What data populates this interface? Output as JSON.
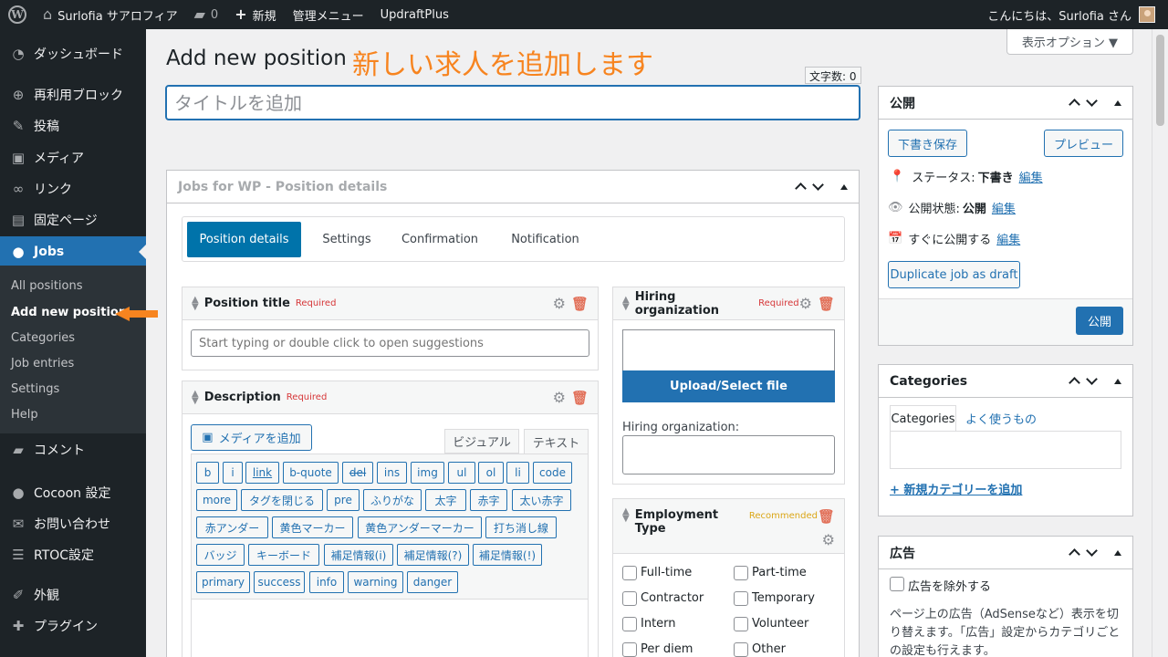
{
  "adminbar": {
    "site_name": "Surlofia サアロフィア",
    "comments_count": "0",
    "new_label": "新規",
    "admin_menu": "管理メニュー",
    "plugin": "UpdraftPlus",
    "greeting": "こんにちは、Surlofia さん"
  },
  "sidebar": {
    "items": [
      {
        "label": "ダッシュボード",
        "icon": "dashboard-icon"
      },
      {
        "label": "再利用ブロック",
        "icon": "plus-circle-icon"
      },
      {
        "label": "投稿",
        "icon": "pin-icon"
      },
      {
        "label": "メディア",
        "icon": "media-icon"
      },
      {
        "label": "リンク",
        "icon": "link-icon"
      },
      {
        "label": "固定ページ",
        "icon": "page-icon"
      },
      {
        "label": "Jobs",
        "icon": "user-icon"
      },
      {
        "label": "コメント",
        "icon": "comment-icon"
      },
      {
        "label": "Cocoon 設定",
        "icon": "circle-icon"
      },
      {
        "label": "お問い合わせ",
        "icon": "mail-icon"
      },
      {
        "label": "RTOC設定",
        "icon": "list-icon"
      },
      {
        "label": "外観",
        "icon": "brush-icon"
      },
      {
        "label": "プラグイン",
        "icon": "plugin-icon"
      }
    ],
    "jobs_submenu": [
      "All positions",
      "Add new position",
      "Categories",
      "Job entries",
      "Settings",
      "Help"
    ]
  },
  "header": {
    "screen_options": "表示オプション ▼",
    "title": "Add new position",
    "annotation": "新しい求人を追加します",
    "char_count": "文字数: 0",
    "title_placeholder": "タイトルを追加"
  },
  "jobbox": {
    "title": "Jobs for WP - Position details",
    "tabs": [
      "Position details",
      "Settings",
      "Confirmation",
      "Notification"
    ],
    "position_title": {
      "label": "Position title",
      "required": "Required",
      "placeholder": "Start typing or double click to open suggestions"
    },
    "description": {
      "label": "Description",
      "required": "Required",
      "add_media": "メディアを追加",
      "visual_tab": "ビジュアル",
      "text_tab": "テキスト",
      "quicktags": [
        [
          "b",
          "i",
          "link",
          "b-quote",
          "del",
          "ins",
          "img",
          "ul",
          "ol",
          "li",
          "code"
        ],
        [
          "more",
          "タグを閉じる",
          "pre",
          "ふりがな",
          "太字",
          "赤字",
          "太い赤字"
        ],
        [
          "赤アンダー",
          "黄色マーカー",
          "黄色アンダーマーカー",
          "打ち消し線"
        ],
        [
          "バッジ",
          "キーボード",
          "補足情報(i)",
          "補足情報(?)",
          "補足情報(!)"
        ],
        [
          "primary",
          "success",
          "info",
          "warning",
          "danger"
        ]
      ]
    },
    "hiring_org": {
      "label": "Hiring organization",
      "required": "Required",
      "upload": "Upload/Select file",
      "field_label": "Hiring organization:"
    },
    "employment": {
      "label": "Employment Type",
      "recommended": "Recommended",
      "options": [
        "Full-time",
        "Part-time",
        "Contractor",
        "Temporary",
        "Intern",
        "Volunteer",
        "Per diem",
        "Other"
      ]
    }
  },
  "publish": {
    "title": "公開",
    "save_draft": "下書き保存",
    "preview": "プレビュー",
    "status_label": "ステータス:",
    "status_value": "下書き",
    "visibility_label": "公開状態:",
    "visibility_value": "公開",
    "schedule": "すぐに公開する",
    "edit": "編集",
    "duplicate": "Duplicate job as draft",
    "publish_button": "公開"
  },
  "categories": {
    "title": "Categories",
    "tab_all": "Categories",
    "tab_popular": "よく使うもの",
    "add_new": "+ 新規カテゴリーを追加"
  },
  "ads": {
    "title": "広告",
    "exclude_label": "広告を除外する",
    "description": "ページ上の広告（AdSenseなど）表示を切り替えます。「広告」設定からカテゴリごとの設定も行えます。"
  },
  "colors": {
    "accent": "#2271b1",
    "annotation": "#f7841f",
    "sidebar": "#1d2327"
  }
}
